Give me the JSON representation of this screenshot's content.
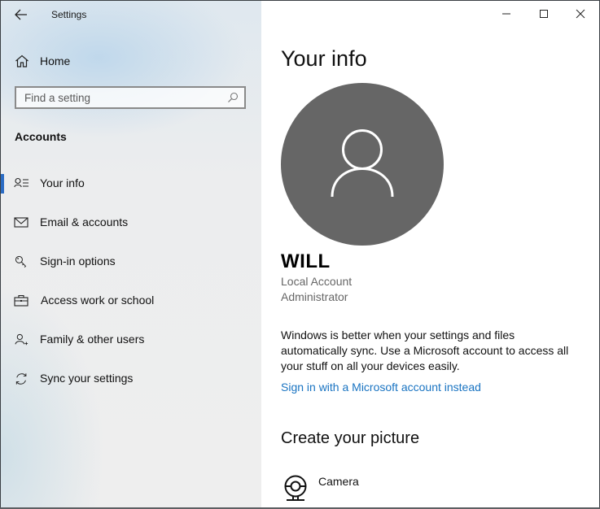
{
  "window": {
    "title": "Settings",
    "controls": {
      "minimize": "minimize-icon",
      "maximize": "maximize-icon",
      "close": "close-icon"
    }
  },
  "sidebar": {
    "back_icon": "arrow-left-icon",
    "home": {
      "label": "Home",
      "icon": "home-icon"
    },
    "search": {
      "placeholder": "Find a setting",
      "value": "",
      "icon": "search-icon"
    },
    "section_label": "Accounts",
    "items": [
      {
        "label": "Your info",
        "icon": "person-list-icon",
        "active": true
      },
      {
        "label": "Email & accounts",
        "icon": "mail-icon",
        "active": false
      },
      {
        "label": "Sign-in options",
        "icon": "key-icon",
        "active": false
      },
      {
        "label": "Access work or school",
        "icon": "briefcase-icon",
        "active": false
      },
      {
        "label": "Family & other users",
        "icon": "person-add-icon",
        "active": false
      },
      {
        "label": "Sync your settings",
        "icon": "sync-icon",
        "active": false
      }
    ]
  },
  "main": {
    "title": "Your info",
    "avatar_icon": "user-avatar-icon",
    "user_name": "WILL",
    "account_type": "Local Account",
    "role": "Administrator",
    "description": "Windows is better when your settings and files automatically sync. Use a Microsoft account to access all your stuff on all your devices easily.",
    "link_label": "Sign in with a Microsoft account instead",
    "create_picture_title": "Create your picture",
    "camera_label": "Camera",
    "camera_icon": "webcam-icon"
  },
  "colors": {
    "accent": "#2b6cc4",
    "link": "#1a74c2",
    "avatar_bg": "#666666"
  }
}
